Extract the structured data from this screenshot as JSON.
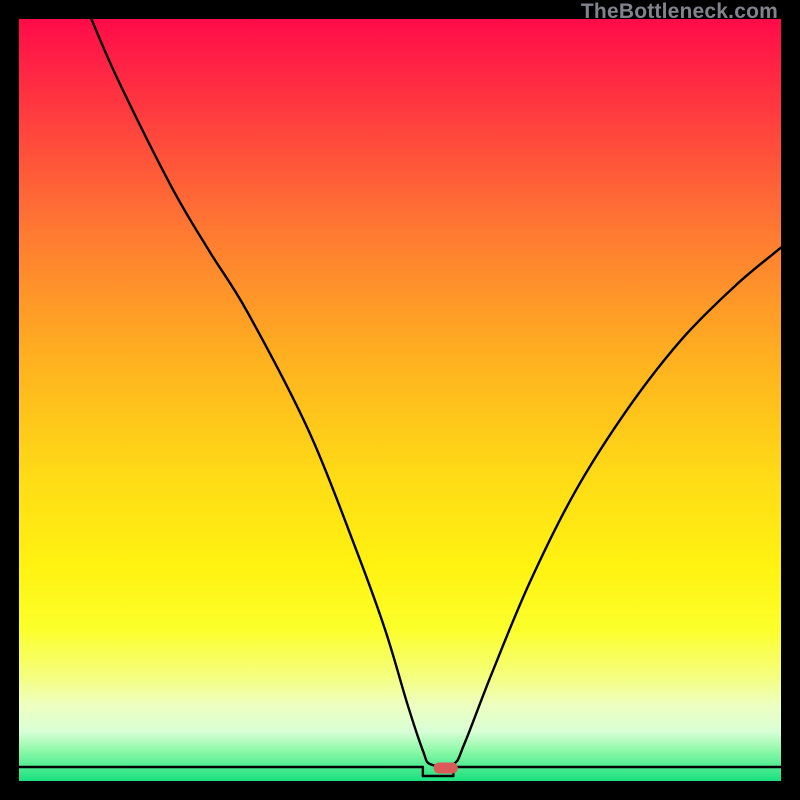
{
  "watermark": "TheBottleneck.com",
  "chart_data": {
    "type": "line",
    "title": "",
    "xlabel": "",
    "ylabel": "",
    "xlim": [
      0,
      100
    ],
    "ylim": [
      0,
      100
    ],
    "notch": {
      "x": 55,
      "width": 4
    },
    "marker": {
      "x": 56,
      "y": 2
    },
    "curve": [
      {
        "x": 9.5,
        "y": 100.0
      },
      {
        "x": 13.0,
        "y": 92.0
      },
      {
        "x": 20.0,
        "y": 78.0
      },
      {
        "x": 25.0,
        "y": 69.5
      },
      {
        "x": 30.0,
        "y": 61.5
      },
      {
        "x": 38.0,
        "y": 46.0
      },
      {
        "x": 44.0,
        "y": 31.0
      },
      {
        "x": 48.0,
        "y": 20.0
      },
      {
        "x": 51.0,
        "y": 10.0
      },
      {
        "x": 53.0,
        "y": 4.0
      },
      {
        "x": 54.0,
        "y": 2.2
      },
      {
        "x": 57.0,
        "y": 2.2
      },
      {
        "x": 58.5,
        "y": 5.0
      },
      {
        "x": 62.0,
        "y": 14.0
      },
      {
        "x": 67.0,
        "y": 26.0
      },
      {
        "x": 73.0,
        "y": 38.0
      },
      {
        "x": 80.0,
        "y": 49.0
      },
      {
        "x": 87.0,
        "y": 58.0
      },
      {
        "x": 94.0,
        "y": 65.0
      },
      {
        "x": 100.0,
        "y": 70.0
      }
    ],
    "gradient_stops": [
      {
        "offset": 0,
        "color": "#ff0b49"
      },
      {
        "offset": 12,
        "color": "#ff3a3f"
      },
      {
        "offset": 28,
        "color": "#ff7a32"
      },
      {
        "offset": 45,
        "color": "#ffb21f"
      },
      {
        "offset": 60,
        "color": "#ffdb16"
      },
      {
        "offset": 72,
        "color": "#fff311"
      },
      {
        "offset": 80,
        "color": "#fcff2a"
      },
      {
        "offset": 86,
        "color": "#f5ff7a"
      },
      {
        "offset": 90,
        "color": "#eeffc0"
      },
      {
        "offset": 93.5,
        "color": "#d9ffd6"
      },
      {
        "offset": 96,
        "color": "#8ef9a8"
      },
      {
        "offset": 100,
        "color": "#18e07e"
      }
    ]
  }
}
